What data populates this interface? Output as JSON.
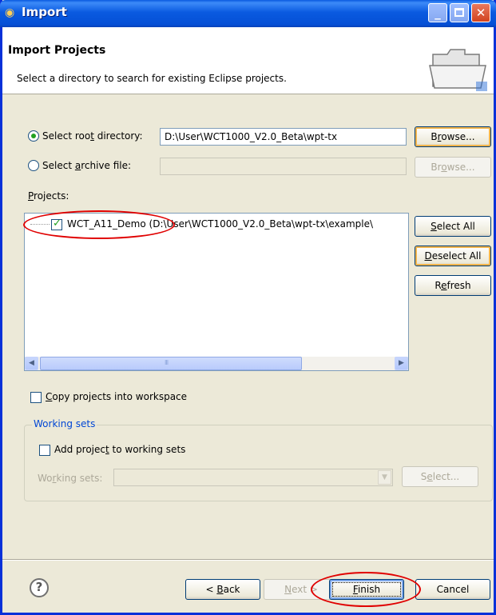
{
  "window": {
    "title": "Import"
  },
  "header": {
    "title": "Import Projects",
    "description": "Select a directory to search for existing Eclipse projects."
  },
  "root": {
    "label_pre": "Select roo",
    "label_mn": "t",
    "label_post": " directory:",
    "value": "D:\\User\\WCT1000_V2.0_Beta\\wpt-tx",
    "browse_pre": "B",
    "browse_mn": "r",
    "browse_post": "owse..."
  },
  "archive": {
    "label_pre": "Select ",
    "label_mn": "a",
    "label_post": "rchive file:",
    "value": "",
    "browse_pre": "Br",
    "browse_mn": "o",
    "browse_post": "wse..."
  },
  "projects": {
    "label_mn": "P",
    "label_post": "rojects:",
    "items": [
      {
        "label": "WCT_A11_Demo (D:\\User\\WCT1000_V2.0_Beta\\wpt-tx\\example\\",
        "checked": true
      }
    ],
    "select_all_pre": "",
    "select_all_mn": "S",
    "select_all_post": "elect All",
    "deselect_all_pre": "",
    "deselect_all_mn": "D",
    "deselect_all_post": "eselect All",
    "refresh_pre": "R",
    "refresh_mn": "e",
    "refresh_post": "fresh"
  },
  "copy": {
    "label_mn": "C",
    "label_post": "opy projects into workspace",
    "checked": false
  },
  "working_sets": {
    "group_title": "Working sets",
    "add_pre": "Add projec",
    "add_mn": "t",
    "add_post": " to working sets",
    "add_checked": false,
    "sets_pre": "Wo",
    "sets_mn": "r",
    "sets_post": "king sets:",
    "sets_value": "",
    "select_pre": "S",
    "select_mn": "e",
    "select_post": "lect..."
  },
  "footer": {
    "help": "?",
    "back_pre": "< ",
    "back_mn": "B",
    "back_post": "ack",
    "next_pre": "",
    "next_mn": "N",
    "next_post": "ext >",
    "finish_pre": "",
    "finish_mn": "F",
    "finish_post": "inish",
    "cancel": "Cancel"
  },
  "colors": {
    "title_bar": "#0a5ae0",
    "dialog_bg": "#ece9d8",
    "annotation": "#e00000",
    "checkmark": "#21a121"
  },
  "icons": {
    "window": "eclipse-icon",
    "header": "open-folder-icon",
    "help": "help-icon"
  }
}
